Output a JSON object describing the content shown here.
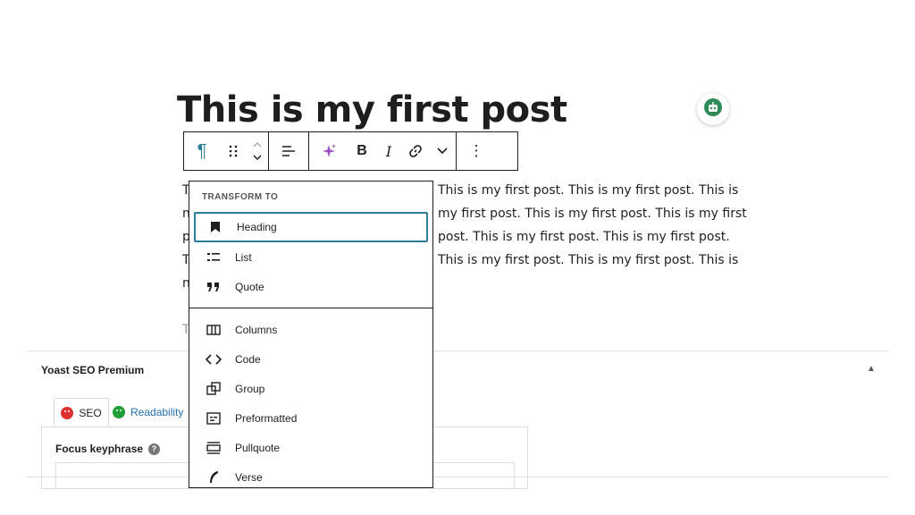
{
  "post": {
    "title": "This is my first post",
    "paragraph_lines": [
      "This is my first post. This is my first post. This is",
      "my first post. This is my first post. This is my first",
      "post. This is my first post. This is my first post.",
      "This is my first post. This is my first post. This is"
    ],
    "hidden_left_chars": [
      "T",
      "n",
      "p",
      "T",
      "n"
    ],
    "hidden_extra": "T"
  },
  "toolbar": {
    "paragraph_icon": "pilcrow-icon",
    "items": [
      "pilcrow-icon",
      "drag-handle-icon",
      "move-up-down-icon",
      "align-icon",
      "ai-sparkle-icon",
      "bold-icon",
      "italic-icon",
      "link-icon",
      "chevron-down-icon",
      "more-options-icon"
    ],
    "bold_label": "B",
    "italic_label": "I",
    "pilcrow_glyph": "¶",
    "more_glyph": "⋮"
  },
  "transform_menu": {
    "header": "TRANSFORM TO",
    "items": [
      {
        "label": "Heading",
        "icon": "bookmark-icon"
      },
      {
        "label": "List",
        "icon": "list-icon"
      },
      {
        "label": "Quote",
        "icon": "quote-icon"
      },
      {
        "label": "Columns",
        "icon": "columns-icon"
      },
      {
        "label": "Code",
        "icon": "code-icon"
      },
      {
        "label": "Group",
        "icon": "group-icon"
      },
      {
        "label": "Preformatted",
        "icon": "preformatted-icon"
      },
      {
        "label": "Pullquote",
        "icon": "pullquote-icon"
      },
      {
        "label": "Verse",
        "icon": "verse-icon"
      }
    ],
    "active": "Heading"
  },
  "yoast": {
    "title": "Yoast SEO Premium",
    "collapse_glyph": "▲",
    "tabs": [
      {
        "label": "SEO",
        "status": "red"
      },
      {
        "label": "Readability",
        "status": "green"
      }
    ],
    "focus_label": "Focus keyphrase",
    "help_glyph": "?"
  },
  "colors": {
    "accent": "#2d7d9a",
    "ai_purple": "#9b4dca",
    "seo_red": "#dc3232",
    "readability_green": "#1f9f36",
    "link_blue": "#2271b1",
    "robot_green": "#2e8b57"
  }
}
